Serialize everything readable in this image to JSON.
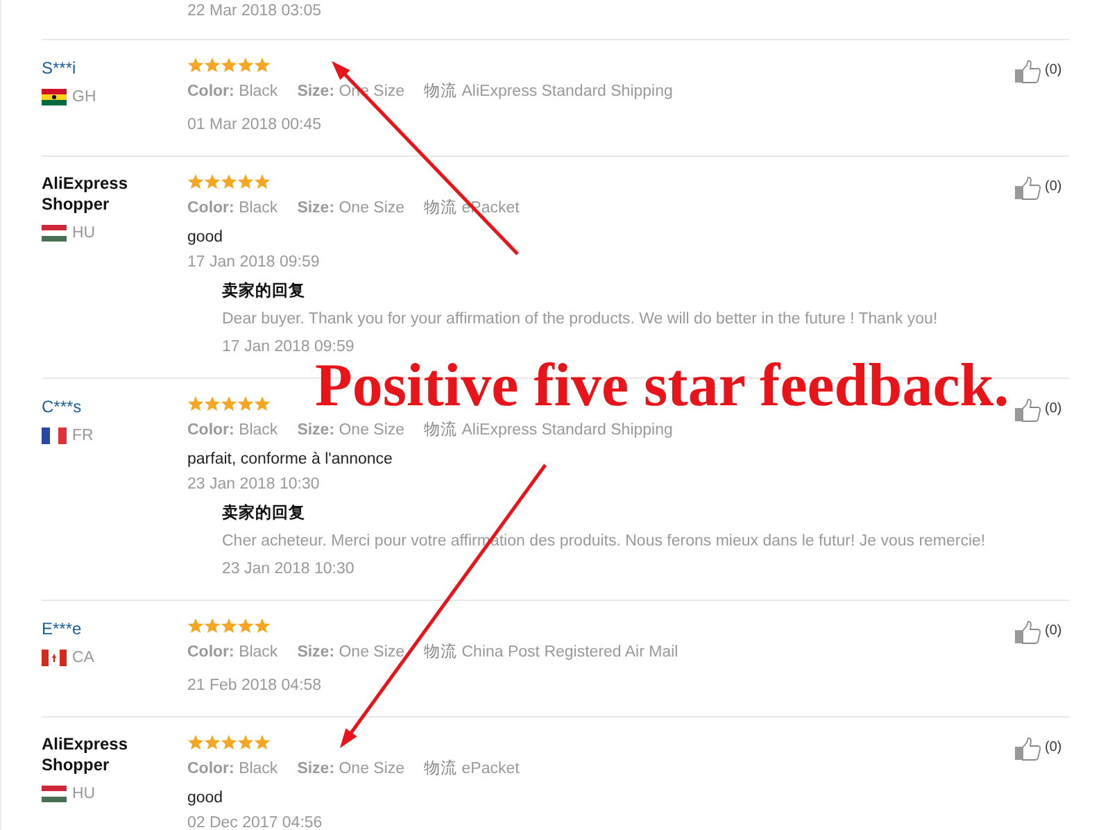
{
  "top_partial_date": "22 Mar 2018 03:05",
  "reviews": [
    {
      "name": "S***i",
      "kind": "buyer",
      "flag": {
        "kind": "gh"
      },
      "country": "GH",
      "stars": 5,
      "specs": [
        {
          "label": "Color:",
          "value": "Black"
        },
        {
          "label": "Size:",
          "value": "One Size"
        },
        {
          "label": "物流",
          "value": "AliExpress Standard Shipping"
        }
      ],
      "date": "01 Mar 2018 00:45",
      "likes": "(0)"
    },
    {
      "name": "AliExpress Shopper",
      "kind": "shopper",
      "flag": {
        "kind": "hu"
      },
      "country": "HU",
      "stars": 5,
      "specs": [
        {
          "label": "Color:",
          "value": "Black"
        },
        {
          "label": "Size:",
          "value": "One Size"
        },
        {
          "label": "物流",
          "value": "ePacket"
        }
      ],
      "comment": "good",
      "date": "17 Jan 2018 09:59",
      "reply": {
        "title": "卖家的回复",
        "text": "Dear buyer. Thank you for your affirmation of the products. We will do better in the future ! Thank you!",
        "date": "17 Jan 2018 09:59"
      },
      "likes": "(0)"
    },
    {
      "name": "C***s",
      "kind": "buyer",
      "flag": {
        "kind": "fr"
      },
      "country": "FR",
      "stars": 5,
      "specs": [
        {
          "label": "Color:",
          "value": "Black"
        },
        {
          "label": "Size:",
          "value": "One Size"
        },
        {
          "label": "物流",
          "value": "AliExpress Standard Shipping"
        }
      ],
      "comment": "parfait, conforme à l'annonce",
      "date": "23 Jan 2018 10:30",
      "reply": {
        "title": "卖家的回复",
        "text": "Cher acheteur. Merci pour votre affirmation des produits. Nous ferons mieux dans le futur! Je vous remercie!",
        "date": "23 Jan 2018 10:30"
      },
      "likes": "(0)"
    },
    {
      "name": "E***e",
      "kind": "buyer",
      "flag": {
        "kind": "ca"
      },
      "country": "CA",
      "stars": 5,
      "specs": [
        {
          "label": "Color:",
          "value": "Black"
        },
        {
          "label": "Size:",
          "value": "One Size"
        },
        {
          "label": "物流",
          "value": "China Post Registered Air Mail"
        }
      ],
      "date": "21 Feb 2018 04:58",
      "likes": "(0)"
    },
    {
      "name": "AliExpress Shopper",
      "kind": "shopper",
      "flag": {
        "kind": "hu"
      },
      "country": "HU",
      "stars": 5,
      "specs": [
        {
          "label": "Color:",
          "value": "Black"
        },
        {
          "label": "Size:",
          "value": "One Size"
        },
        {
          "label": "物流",
          "value": "ePacket"
        }
      ],
      "comment": "good",
      "date": "02 Dec 2017 04:56",
      "likes": "(0)"
    }
  ],
  "annotation": {
    "text": "Positive five star feedback."
  }
}
